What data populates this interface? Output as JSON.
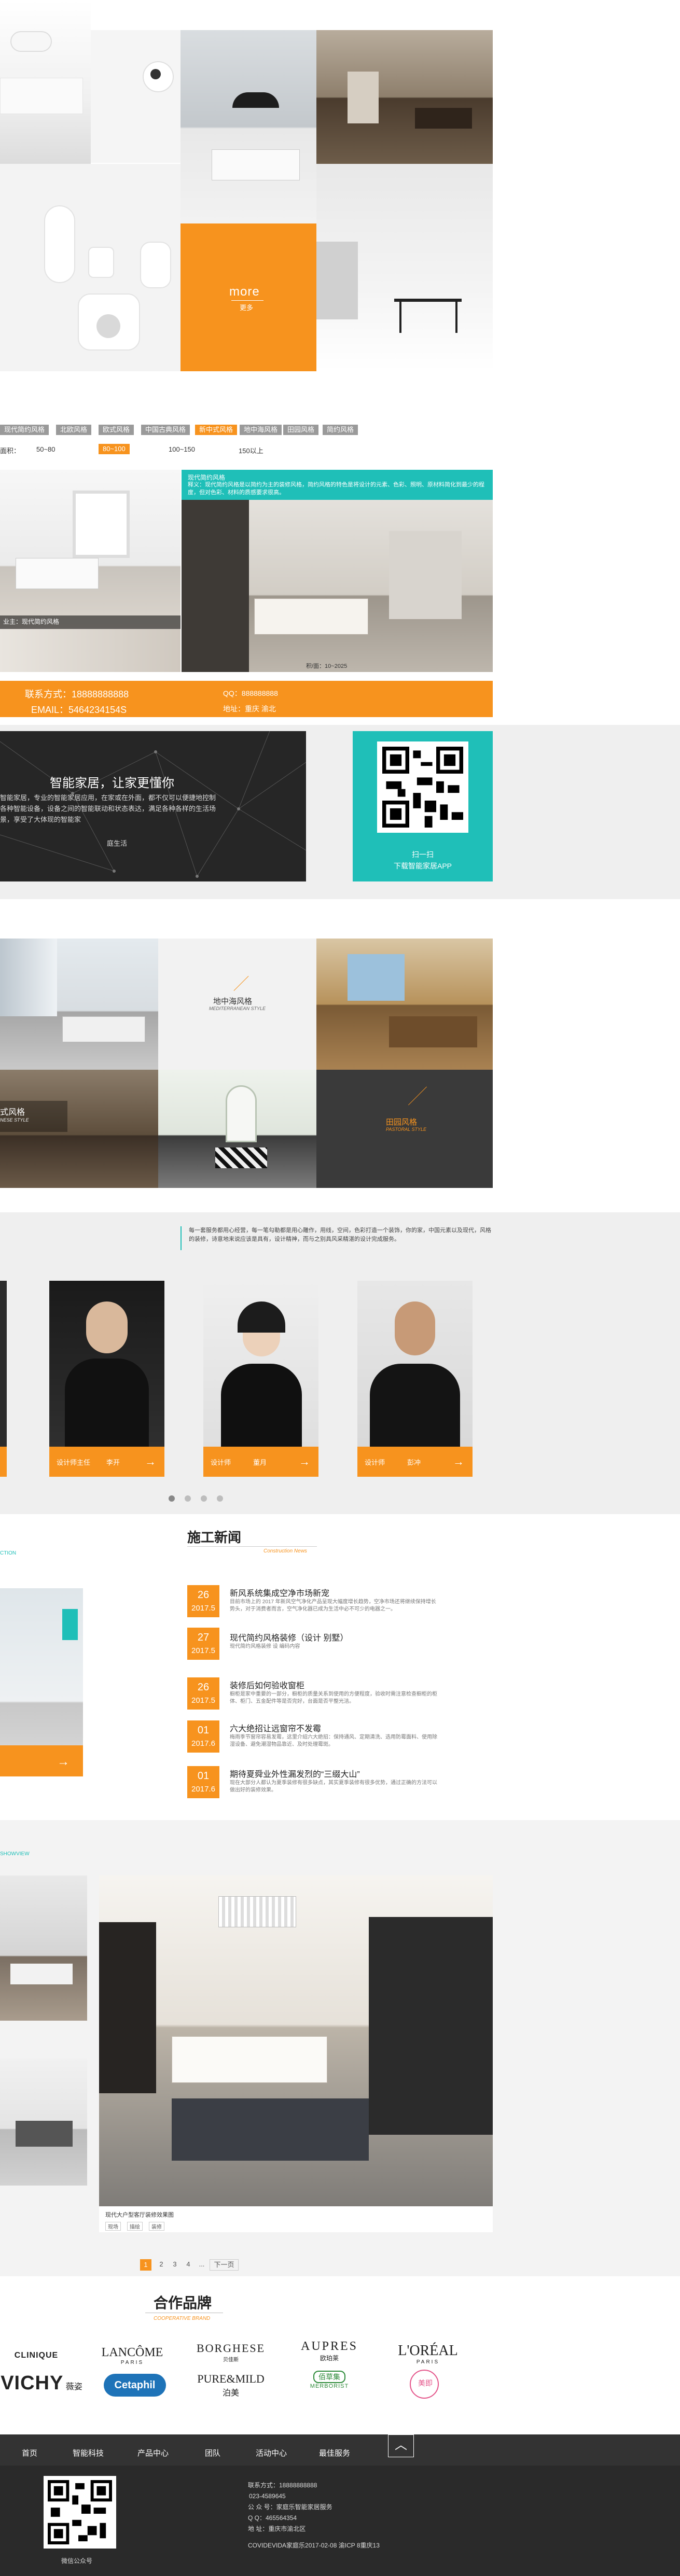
{
  "hero": {
    "more_label": "more",
    "more_sub": "更多"
  },
  "filters": {
    "style_tags": [
      "现代简约风格",
      "北欧风格",
      "欧式风格",
      "中国古典风格",
      "新中式风格",
      "地中海风格",
      "田园风格",
      "简约风格"
    ],
    "style_active_index": 4,
    "area_label": "面积：",
    "area_options": [
      "50~80",
      "80~100",
      "100~150",
      "150以上"
    ],
    "area_active_index": 1
  },
  "case": {
    "caption": "现代简约风格",
    "title": "现代简约风格",
    "desc": "释义：现代简约风格是以简约为主的装修风格，简约风格的特色是将设计的元素、色彩、照明、原材料简化到最少的程度，但对色彩、材料的质感要求很高。",
    "area_info": "积/面：10~2025",
    "thumb_caption": "业主：现代简约风格"
  },
  "contact_bar": {
    "phone_label": "联系方式：18888888888",
    "email_label": "EMAIL：5464234154S",
    "qq_label": "QQ：888888888",
    "address_label": "地址：重庆 渝北"
  },
  "app_banner": {
    "headline": "智能家居，让家更懂你",
    "body": "智能家居，专业的智能家居应用，在家或在外面，都不仅可以便捷地控制各种智能设备，设备之间的智能联动和状态表达，满足各种各样的生活场景，享受了大体现的智能家",
    "body2": "庭生活",
    "scan_label": "扫一扫",
    "download_label": "下载智能家居APP"
  },
  "styles_grid": {
    "mediterranean_cn": "地中海风格",
    "mediterranean_en": "MEDITERRANEAN STYLE",
    "pastoral_cn": "田园风格",
    "pastoral_en": "PASTORAL STYLE",
    "chinese_cn": "式风格",
    "chinese_en": "NESE STYLE"
  },
  "team": {
    "intro": "每一套服务都用心经营，每一笔勾勒都是用心雕作，用线，空间，色彩打造一个装饰，你的家，中国元素以及现代，风格的装修，诗意地来说应该是具有，设计精神，而与之别具风采精湛的设计完成服务。",
    "members": [
      {
        "role": "设计师主任",
        "name": "李开"
      },
      {
        "role": "设计师",
        "name": "董月"
      },
      {
        "role": "设计师",
        "name": "彭冲"
      }
    ],
    "active_dot": 0,
    "dots": 4
  },
  "news": {
    "section_en_left": "CTION",
    "title": "施工新闻",
    "title_en": "Construction News",
    "items": [
      {
        "day": "26",
        "ym": "2017.5",
        "title": "新风系统集成空净市场新宠",
        "summary": "目前市场上的 2017 年新风空气净化产品呈现大幅度增长趋势，空净市场还将继续保持增长势头，对于消费者而言，空气净化器已成为生活中必不可少的电器之一。"
      },
      {
        "day": "27",
        "ym": "2017.5",
        "title": "现代简约风格装修（设计 别墅）",
        "summary": "现代简约风格装修 设 编码内容"
      },
      {
        "day": "26",
        "ym": "2017.5",
        "title": "装修后如何验收窗柜",
        "summary": "橱柜是家中重要的一部分，橱柜的质量关系到使用的方便程度，验收时需注意检查橱柜的柜体、柜门、五金配件等是否完好，台面是否平整光洁。"
      },
      {
        "day": "01",
        "ym": "2017.6",
        "title": "六大绝招让远窗帘不发霉",
        "summary": "梅雨季节窗帘容易发霉，这里介绍六大绝招：保持通风、定期清洗、选用防霉面料、使用除湿设备、避免潮湿物品靠近、及时处理霉斑。"
      },
      {
        "day": "01",
        "ym": "2017.6",
        "title": "期待夏舜业外性漏发烈的“三缀大山”",
        "summary": "现在大部分人都认为夏季装修有很多缺点，其实夏季装修有很多优势，通过正确的方法可以做出好的装修效果。"
      }
    ]
  },
  "gallery": {
    "section_en_left": "SHOWVIEW",
    "main_caption": "现代大户型客厅装修效果图",
    "main_tags": [
      "现场",
      "描绘",
      "装修"
    ],
    "pages": [
      "1",
      "2",
      "3",
      "4",
      "..."
    ],
    "next_label": "下一页",
    "active_page": 0
  },
  "brands": {
    "title": "合作品牌",
    "subtitle": "COOPERATIVE BRAND",
    "row1": [
      "CLINIQUE",
      "LANCÔME",
      "BORGHESE",
      "AUPRES",
      "L'ORÉAL"
    ],
    "row1_sub": [
      "",
      "PARIS",
      "贝佳斯",
      "欧珀莱",
      "PARIS"
    ],
    "row2": [
      "VICHY",
      "Cetaphil",
      "PURE&MILD",
      "MERBORIST",
      "美即"
    ],
    "row2_sub": [
      "薇姿",
      "",
      "泊美",
      "佰草集",
      ""
    ]
  },
  "footer": {
    "nav": [
      "首页",
      "智能科技",
      "产品中心",
      "团队",
      "活动中心",
      "最佳服务"
    ],
    "top_icon": "up-arrow-icon",
    "contacts": [
      "联系方式：18888888888",
      "023-4589645",
      "公 众 号：家庭乐智能家居服务",
      "Q    Q：465564354",
      "地    址：重庆市渝北区"
    ],
    "copyright": "COVIDEVIDA家庭乐2017-02-08   渝ICP 8重庆13",
    "qr_caption": "微信公众号",
    "colors": {
      "nav_bg": "#333333",
      "footer_bg": "#2a2a2a"
    }
  },
  "colors": {
    "accent": "#f7931e",
    "teal": "#1fbfb8"
  }
}
